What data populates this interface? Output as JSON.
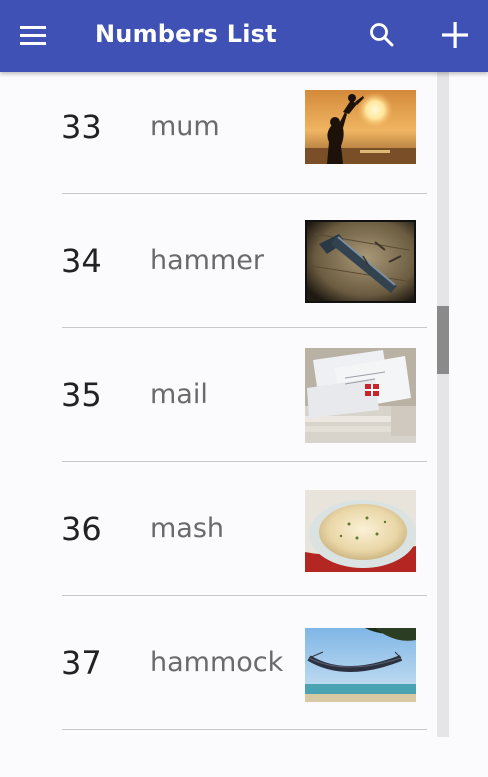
{
  "app_bar": {
    "title": "Numbers List",
    "color": "#3f51b5",
    "menu_icon": "hamburger-menu-icon",
    "search_icon": "search-icon",
    "add_icon": "plus-icon"
  },
  "items": [
    {
      "number": "33",
      "word": "mum",
      "image": "mother-child-sunset-photo"
    },
    {
      "number": "34",
      "word": "hammer",
      "image": "hammer-photo"
    },
    {
      "number": "35",
      "word": "mail",
      "image": "mail-stack-photo"
    },
    {
      "number": "36",
      "word": "mash",
      "image": "mashed-potato-photo"
    },
    {
      "number": "37",
      "word": "hammock",
      "image": "hammock-photo"
    }
  ]
}
